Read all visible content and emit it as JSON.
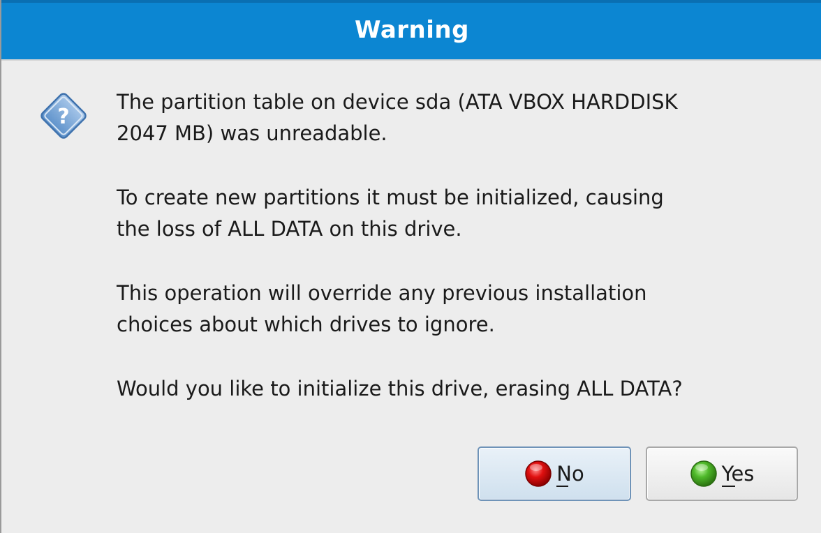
{
  "dialog": {
    "title": "Warning",
    "icon": "question-icon",
    "paragraphs": [
      "The partition table on device sda (ATA VBOX HARDDISK\n2047 MB) was unreadable.",
      "To create new partitions it must be initialized, causing\nthe loss of ALL DATA on this drive.",
      "This operation will override any previous installation\nchoices about which drives to ignore.",
      "Would you like to initialize this drive, erasing ALL DATA?"
    ]
  },
  "buttons": {
    "no": {
      "label": "No",
      "icon": "red-circle-icon",
      "color": "#d40000"
    },
    "yes": {
      "label": "Yes",
      "icon": "green-circle-icon",
      "color": "#3da321"
    }
  },
  "colors": {
    "titlebar": "#0c86d2",
    "background": "#ededed"
  }
}
